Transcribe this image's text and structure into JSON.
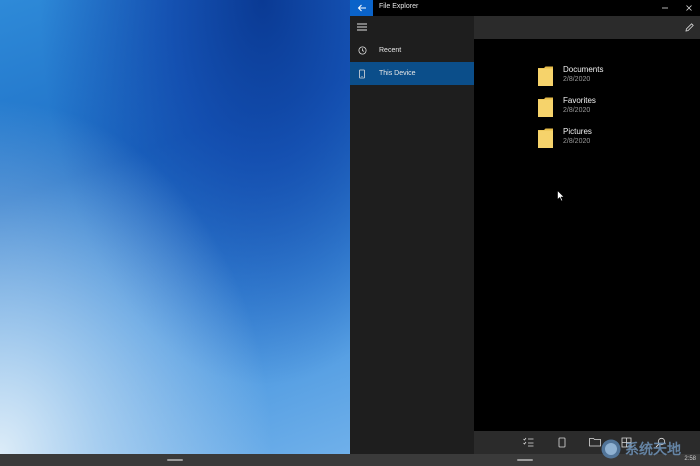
{
  "window": {
    "title": "File Explorer"
  },
  "sidebar": {
    "items": [
      {
        "label": "Recent",
        "icon": "clock-icon",
        "selected": false
      },
      {
        "label": "This Device",
        "icon": "device-icon",
        "selected": true
      }
    ]
  },
  "folders": [
    {
      "name": "Documents",
      "date": "2/8/2020"
    },
    {
      "name": "Favorites",
      "date": "2/8/2020"
    },
    {
      "name": "Pictures",
      "date": "2/8/2020"
    }
  ],
  "taskbar": {
    "clock": "2:58"
  },
  "watermark": {
    "text": "系统天地"
  },
  "colors": {
    "accent": "#0a63c9",
    "selected_nav": "#0b4e8a",
    "folder_yellow": "#f6d36b"
  }
}
